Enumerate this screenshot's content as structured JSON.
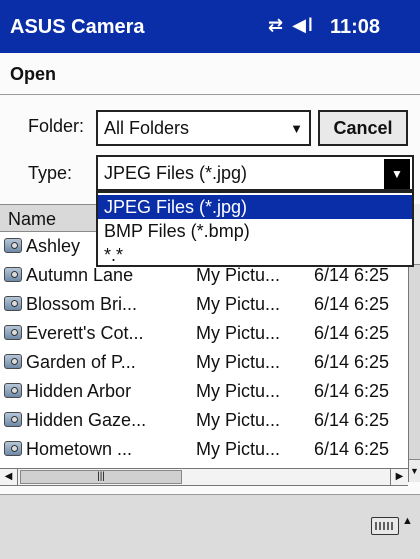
{
  "titlebar": {
    "app_title": "ASUS Camera",
    "status_icons": "⇄ ◀ǀ",
    "time": "11:08"
  },
  "dialog": {
    "title": "Open"
  },
  "form": {
    "folder_label": "Folder:",
    "folder_value": "All Folders",
    "cancel_label": "Cancel",
    "type_label": "Type:",
    "type_value": "JPEG Files (*.jpg)",
    "type_options": [
      "JPEG Files (*.jpg)",
      "BMP Files (*.bmp)",
      "*.*"
    ]
  },
  "list": {
    "header_name": "Name",
    "rows": [
      {
        "name": "Ashley",
        "folder": "",
        "date": ""
      },
      {
        "name": "Autumn Lane",
        "folder": "My Pictu...",
        "date": "6/14 6:25"
      },
      {
        "name": "Blossom Bri...",
        "folder": "My Pictu...",
        "date": "6/14 6:25"
      },
      {
        "name": "Everett's Cot...",
        "folder": "My Pictu...",
        "date": "6/14 6:25"
      },
      {
        "name": "Garden of P...",
        "folder": "My Pictu...",
        "date": "6/14 6:25"
      },
      {
        "name": "Hidden Arbor",
        "folder": "My Pictu...",
        "date": "6/14 6:25"
      },
      {
        "name": "Hidden Gaze...",
        "folder": "My Pictu...",
        "date": "6/14 6:25"
      },
      {
        "name": "Hometown ...",
        "folder": "My Pictu...",
        "date": "6/14 6:25"
      }
    ]
  },
  "colors": {
    "titlebar": "#0a2ea8",
    "selection": "#0a2ea8"
  },
  "icons": {
    "status": "network-and-volume-icons",
    "keyboard": "keyboard-icon",
    "file": "image-file-icon"
  }
}
